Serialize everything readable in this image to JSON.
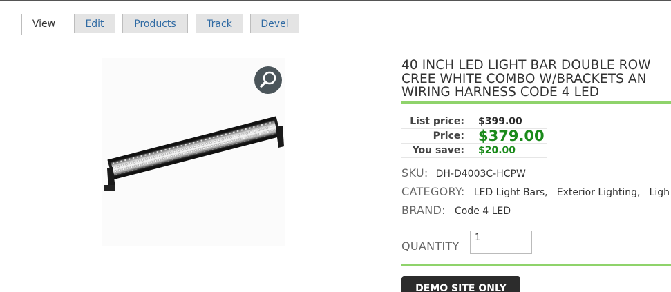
{
  "tabs": [
    {
      "label": "View"
    },
    {
      "label": "Edit"
    },
    {
      "label": "Products"
    },
    {
      "label": "Track"
    },
    {
      "label": "Devel"
    }
  ],
  "product": {
    "title": "40 INCH LED LIGHT BAR DOUBLE ROW\nCREE WHITE COMBO W/BRACKETS AN\nWIRING HARNESS CODE 4 LED",
    "image_icon": "led-light-bar-image",
    "zoom_icon": "magnifier-icon"
  },
  "prices": {
    "list_label": "List price:",
    "list_value": "$399.00",
    "price_label": "Price:",
    "price_value": "$379.00",
    "save_label": "You save:",
    "save_value": "$20.00"
  },
  "meta": {
    "sku_label": "SKU:",
    "sku_value": "DH-D4003C-HCPW",
    "category_label": "CATEGORY:",
    "categories": [
      "LED Light Bars,",
      "Exterior Lighting,",
      "Ligh"
    ],
    "brand_label": "BRAND:",
    "brand_value": "Code 4 LED"
  },
  "cart": {
    "quantity_label": "QUANTITY",
    "quantity_value": "1",
    "button_label": "DEMO SITE ONLY"
  },
  "colors": {
    "accent_green": "#8fd36b",
    "price_green": "#1a8a1a",
    "tab_link": "#2f6aa3"
  }
}
